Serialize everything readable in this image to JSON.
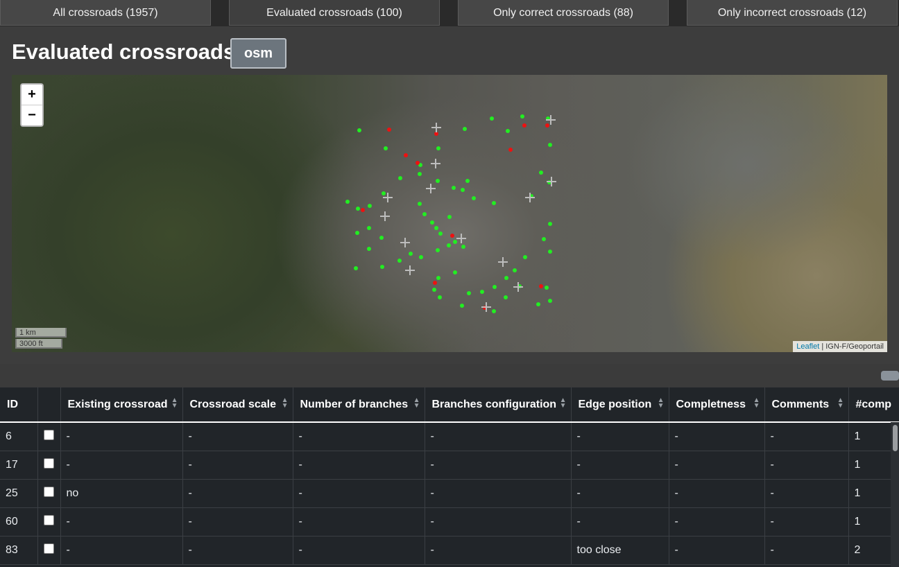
{
  "tabs": [
    {
      "label": "All crossroads (1957)"
    },
    {
      "label": "Evaluated crossroads (100)"
    },
    {
      "label": "Only correct crossroads (88)"
    },
    {
      "label": "Only incorrect crossroads (12)"
    }
  ],
  "panel": {
    "title": "Evaluated crossroads",
    "layer_button": "osm"
  },
  "map": {
    "zoom_in": "+",
    "zoom_out": "−",
    "scale_km": "1 km",
    "scale_ft": "3000 ft",
    "attribution_link": "Leaflet",
    "attribution_text": " | IGN-F/Geoportail",
    "colors": {
      "correct": "#22ee22",
      "incorrect": "#ee1111"
    }
  },
  "table": {
    "columns": [
      "ID",
      "",
      "Existing crossroad",
      "Crossroad scale",
      "Number of branches",
      "Branches configuration",
      "Edge position",
      "Completness",
      "Comments",
      "#comp"
    ],
    "rows": [
      {
        "id": "6",
        "existing": "-",
        "scale": "-",
        "branches": "-",
        "config": "-",
        "edge": "-",
        "complete": "-",
        "comments": "-",
        "comp": "1"
      },
      {
        "id": "17",
        "existing": "-",
        "scale": "-",
        "branches": "-",
        "config": "-",
        "edge": "-",
        "complete": "-",
        "comments": "-",
        "comp": "1"
      },
      {
        "id": "25",
        "existing": "no",
        "scale": "-",
        "branches": "-",
        "config": "-",
        "edge": "-",
        "complete": "-",
        "comments": "-",
        "comp": "1"
      },
      {
        "id": "60",
        "existing": "-",
        "scale": "-",
        "branches": "-",
        "config": "-",
        "edge": "-",
        "complete": "-",
        "comments": "-",
        "comp": "1"
      },
      {
        "id": "83",
        "existing": "-",
        "scale": "-",
        "branches": "-",
        "config": "-",
        "edge": "too close",
        "complete": "-",
        "comments": "-",
        "comp": "2"
      }
    ]
  }
}
